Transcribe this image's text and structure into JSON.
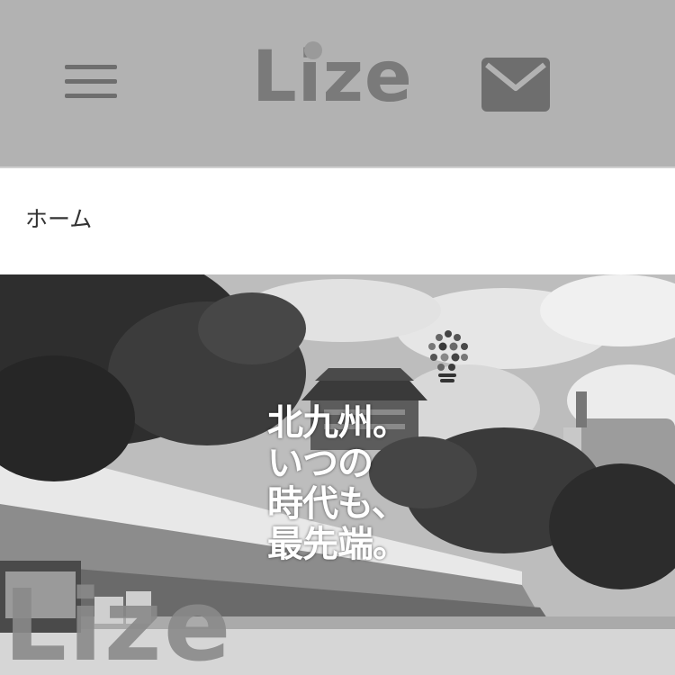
{
  "header": {
    "menu_icon": "hamburger-menu-icon",
    "logo_text": "Lize",
    "mail_icon": "envelope-icon"
  },
  "breadcrumb": {
    "items": [
      "ホーム"
    ]
  },
  "hero": {
    "headline_lines": [
      "北九州。",
      "いつの",
      "時代も、",
      "最先端。"
    ],
    "watermark_logo": "Lize",
    "bulb_icon": "lightbulb-dots-icon"
  },
  "colors": {
    "header_bg": "#b2b2b2",
    "logo": "#7a7a7a",
    "icon": "#6e6e6e",
    "breadcrumb_text": "#333333",
    "headline_text": "#ffffff"
  }
}
